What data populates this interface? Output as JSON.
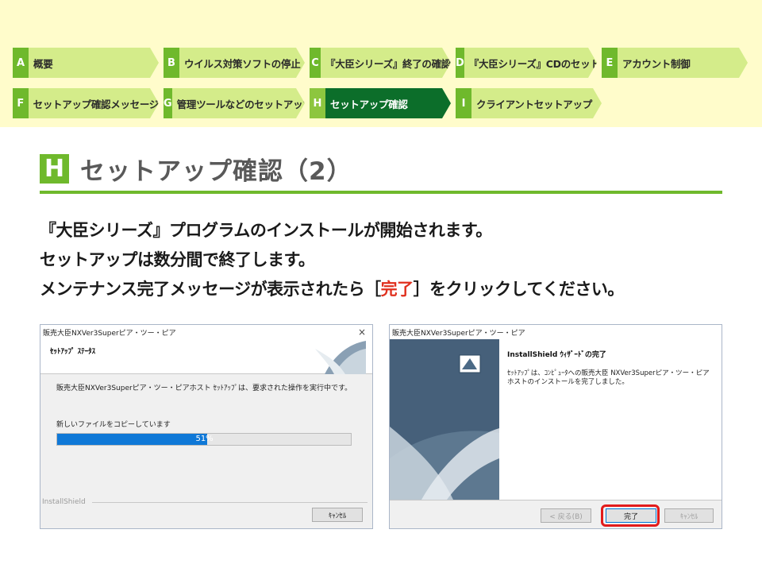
{
  "nav": {
    "row1": [
      {
        "letter": "A",
        "label": "概要",
        "width": 184
      },
      {
        "letter": "B",
        "label": "ウイルス対策ソフトの停止",
        "width": 178
      },
      {
        "letter": "C",
        "label": "『大臣シリーズ』終了の確認",
        "width": 178
      },
      {
        "letter": "D",
        "label": "『大臣シリーズ』CDのセット",
        "width": 178
      },
      {
        "letter": "E",
        "label": "アカウント制御",
        "width": 184
      }
    ],
    "row2": [
      {
        "letter": "F",
        "label": "セットアップ確認メッセージ",
        "width": 184
      },
      {
        "letter": "G",
        "label": "管理ツールなどのセットアップ",
        "width": 178
      },
      {
        "letter": "H",
        "label": "セットアップ確認",
        "width": 178,
        "active": true
      },
      {
        "letter": "I",
        "label": "クライアントセットアップ",
        "width": 184
      }
    ]
  },
  "section": {
    "letter": "H",
    "title": "セットアップ確認（2）"
  },
  "body": {
    "line1": "『大臣シリーズ』プログラムのインストールが開始されます。",
    "line2": "セットアップは数分間で終了します。",
    "line3_pre": "メンテナンス完了メッセージが表示されたら［",
    "line3_hl": "完了",
    "line3_post": "］をクリックしてください。"
  },
  "dialog1": {
    "title": "販売大臣NXVer3Superピア・ツー・ピア",
    "close": "×",
    "header": "ｾｯﾄｱｯﾌﾟ ｽﾃｰﾀｽ",
    "status": "販売大臣NXVer3Superピア・ツー・ピアホスト ｾｯﾄｱｯﾌﾟは、要求された操作を実行中です。",
    "copying": "新しいファイルをコピーしています",
    "progress": 51,
    "progress_label": "51%",
    "brand": "InstallShield",
    "cancel": "ｷｬﾝｾﾙ"
  },
  "dialog2": {
    "title": "販売大臣NXVer3Superピア・ツー・ピア",
    "wizard_title": "InstallShield ｳｨｻﾞｰﾄﾞの完了",
    "wizard_body": "ｾｯﾄｱｯﾌﾟは、ｺﾝﾋﾟｭｰﾀへの販売大臣 NXVer3Superピア・ツー・ピアホストのインストールを完了しました。",
    "back": "< 戻る(B)",
    "finish": "完了",
    "cancel": "ｷｬﾝｾﾙ"
  },
  "colors": {
    "accent": "#6fb92c",
    "active_nav": "#0c6e2a",
    "highlight": "#e0301e",
    "progress": "#0f78d7"
  }
}
